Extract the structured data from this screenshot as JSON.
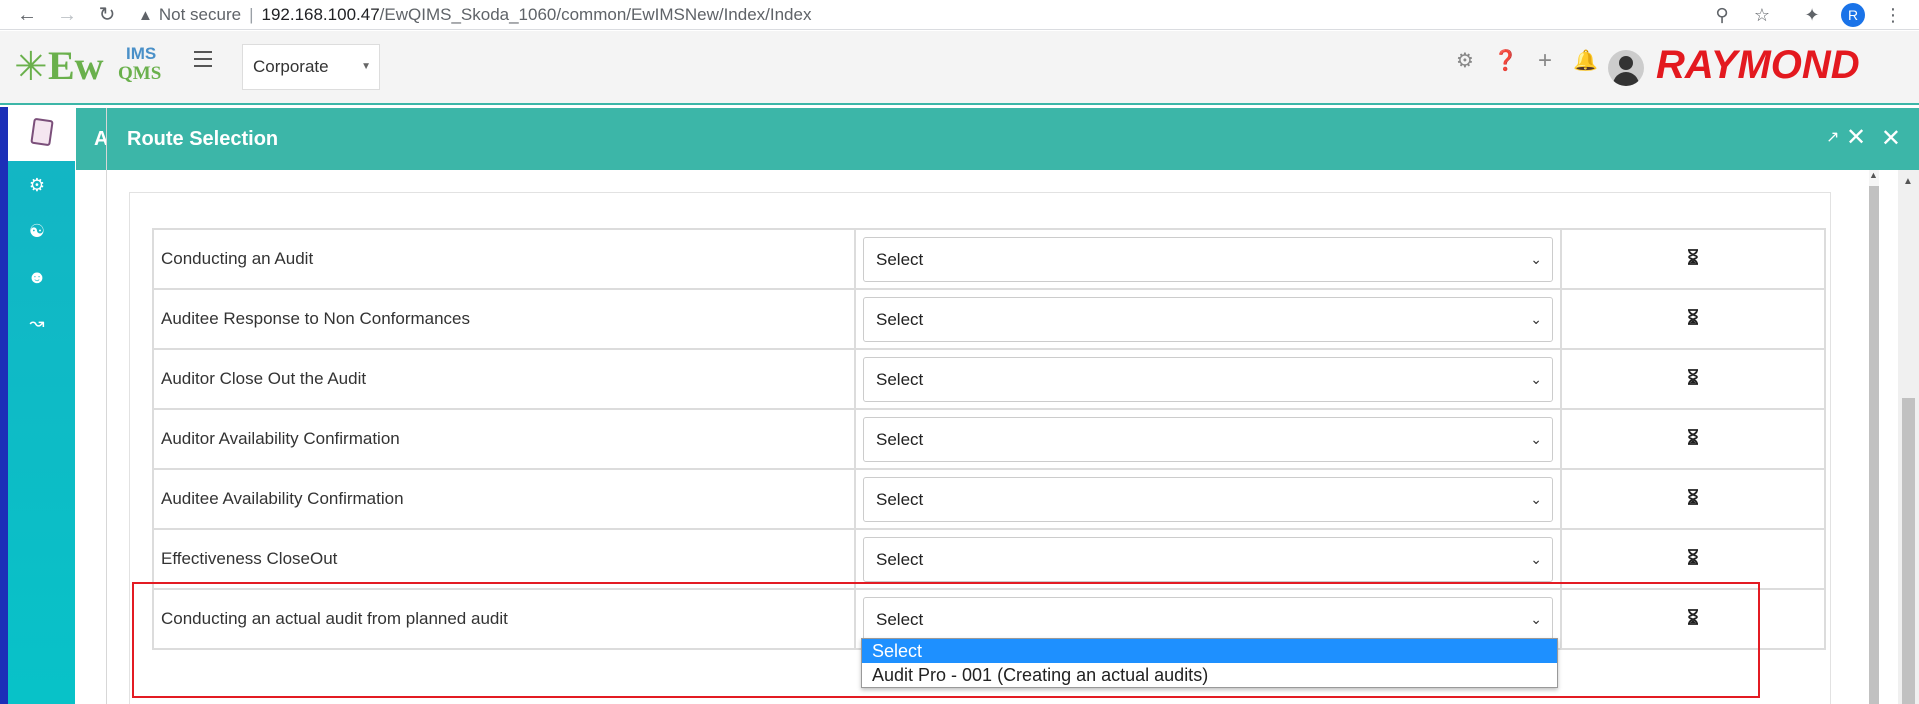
{
  "browser": {
    "not_secure": "Not secure",
    "host": "192.168.100.47",
    "path": "/EwQIMS_Skoda_1060/common/EwIMSNew/Index/Index",
    "profile_initial": "R"
  },
  "header": {
    "logo_ew": "Ew",
    "logo_ims": "IMS",
    "logo_qms": "QMS",
    "corporate_select": "Corporate",
    "brand": "RAYMOND"
  },
  "background_panel": {
    "title_initial": "A"
  },
  "modal": {
    "title": "Route Selection",
    "rows": [
      {
        "name": "Conducting an Audit",
        "select": "Select"
      },
      {
        "name": "Auditee Response to Non Conformances",
        "select": "Select"
      },
      {
        "name": "Auditor Close Out the Audit",
        "select": "Select"
      },
      {
        "name": "Auditor Availability Confirmation",
        "select": "Select"
      },
      {
        "name": "Auditee Availability Confirmation",
        "select": "Select"
      },
      {
        "name": "Effectiveness CloseOut",
        "select": "Select"
      },
      {
        "name": "Conducting an actual audit from planned audit",
        "select": "Select"
      }
    ],
    "dropdown_options": [
      "Select",
      "Audit Pro - 001 (Creating an actual audits)"
    ]
  },
  "colors": {
    "teal": "#3cb6a8",
    "highlight_red": "#e31b23",
    "option_highlight": "#1e90ff",
    "brand_red": "#e3191f"
  }
}
